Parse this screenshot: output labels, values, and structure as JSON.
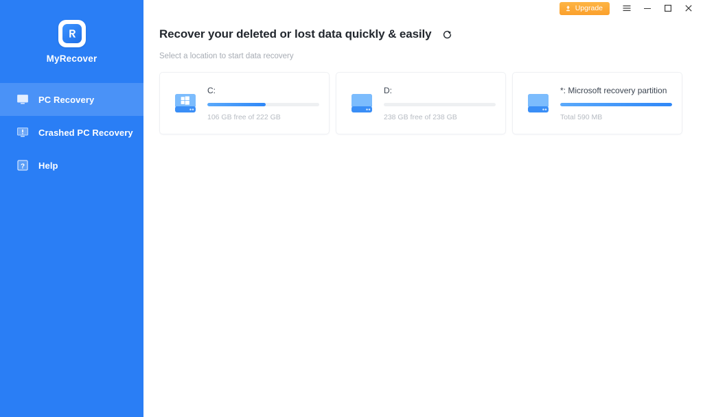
{
  "sidebar": {
    "brand": {
      "name": "MyRecover",
      "logo_icon": "myrecover-logo-icon"
    },
    "items": [
      {
        "label": "PC Recovery",
        "icon": "monitor-icon",
        "active": true
      },
      {
        "label": "Crashed PC Recovery",
        "icon": "monitor-alert-icon",
        "active": false
      },
      {
        "label": "Help",
        "icon": "question-mark-icon",
        "active": false
      }
    ]
  },
  "titlebar": {
    "upgrade_label": "Upgrade",
    "upgrade_icon": "upgrade-arrow-icon",
    "menu_icon": "hamburger-menu-icon",
    "minimize_icon": "minimize-icon",
    "maximize_icon": "maximize-icon",
    "close_icon": "close-icon"
  },
  "main": {
    "title": "Recover your deleted or lost data quickly & easily",
    "refresh_icon": "refresh-icon",
    "subtitle": "Select a location to start data recovery",
    "drives": [
      {
        "name": "C:",
        "status": "106 GB free of 222 GB",
        "used_percent": 52,
        "icon": "windows-disk-icon"
      },
      {
        "name": "D:",
        "status": "238 GB free of 238 GB",
        "used_percent": 0,
        "icon": "disk-icon"
      },
      {
        "name": "*: Microsoft recovery partition",
        "status": "Total 590 MB",
        "used_percent": 100,
        "icon": "disk-icon"
      }
    ]
  },
  "colors": {
    "sidebar_bg": "#2a7ef5",
    "sidebar_active": "#4a92f7",
    "accent": "#2f87f7",
    "upgrade": "#fba02c",
    "title_text": "#22272e",
    "muted_text": "#a7acb4"
  }
}
